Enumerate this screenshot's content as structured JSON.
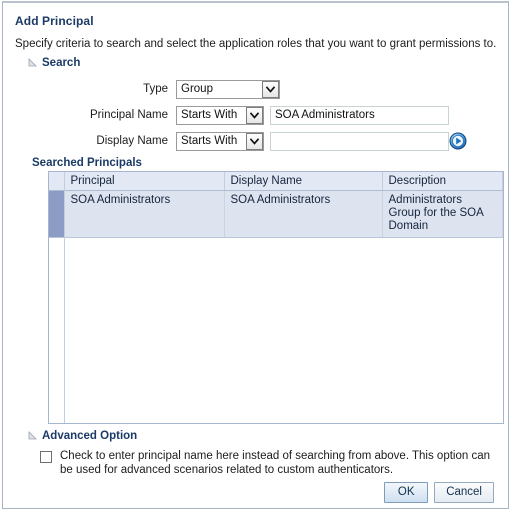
{
  "dialog": {
    "title": "Add Principal",
    "instruction": "Specify criteria to search and select the application roles that you want to grant permissions to."
  },
  "search_section": {
    "label": "Search",
    "disclosure_icon": "triangle-expanded-icon",
    "fields": {
      "type": {
        "label": "Type",
        "value": "Group",
        "dropdown_icon": "chevron-down-icon"
      },
      "principal_name": {
        "label": "Principal Name",
        "operator": "Starts With",
        "operator_icon": "chevron-down-icon",
        "value": "SOA Administrators",
        "placeholder": ""
      },
      "display_name": {
        "label": "Display Name",
        "operator": "Starts With",
        "operator_icon": "chevron-down-icon",
        "value": "",
        "placeholder": ""
      }
    },
    "go_button": {
      "icon": "search-go-arrow-icon",
      "title": "Search"
    }
  },
  "results_section": {
    "label": "Searched Principals",
    "disclosure_icon": "triangle-expanded-icon",
    "columns": [
      "Principal",
      "Display Name",
      "Description"
    ],
    "rows": [
      {
        "selected": true,
        "principal": "SOA Administrators",
        "display_name": "SOA Administrators",
        "description": "Administrators Group for the SOA Domain"
      }
    ]
  },
  "advanced_section": {
    "label": "Advanced Option",
    "disclosure_icon": "triangle-expanded-icon",
    "checkbox": {
      "checked": false,
      "label": "Check to enter principal name here instead of searching from above. This option can be used for advanced scenarios related to custom authenticators."
    }
  },
  "footer": {
    "ok_label": "OK",
    "cancel_label": "Cancel"
  },
  "colors": {
    "title_blue": "#1b3a66",
    "header_row_bg": "#e3e9f4",
    "selected_row_bg": "#dde4f0",
    "selector_cell_bg": "#8d9cc4",
    "grid_border": "#a6b6cf",
    "primary_button": "#cfe0ef"
  }
}
